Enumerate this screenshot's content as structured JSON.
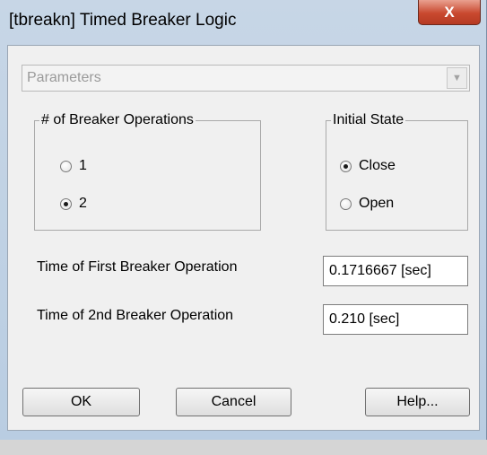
{
  "window": {
    "title": "[tbreakn] Timed Breaker Logic",
    "close_glyph": "X"
  },
  "combo": {
    "value": "Parameters"
  },
  "operations_group": {
    "legend": "# of Breaker Operations",
    "options": [
      {
        "label": "1",
        "selected": false
      },
      {
        "label": "2",
        "selected": true
      }
    ]
  },
  "state_group": {
    "legend": "Initial State",
    "options": [
      {
        "label": "Close",
        "selected": true
      },
      {
        "label": "Open",
        "selected": false
      }
    ]
  },
  "fields": {
    "first_label": "Time of First Breaker Operation",
    "first_value": "0.1716667 [sec]",
    "second_label": "Time of 2nd Breaker Operation",
    "second_value": "0.210 [sec]"
  },
  "buttons": {
    "ok": "OK",
    "cancel": "Cancel",
    "help": "Help..."
  }
}
